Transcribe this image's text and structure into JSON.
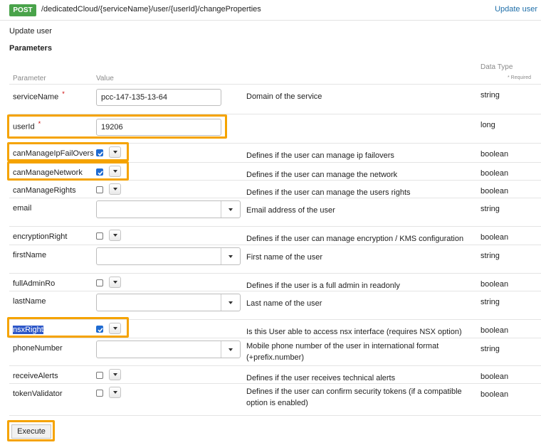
{
  "endpoint": {
    "method": "POST",
    "path": "/dedicatedCloud/{serviceName}/user/{userId}/changeProperties",
    "action_link": "Update user",
    "description": "Update user"
  },
  "section_title": "Parameters",
  "headers": {
    "parameter": "Parameter",
    "value": "Value",
    "data_type": "Data Type",
    "required_note": "* Required"
  },
  "params": [
    {
      "name": "serviceName",
      "required": true,
      "control": "text",
      "value": "pcc-147-135-13-64",
      "description": "Domain of the service",
      "type": "string"
    },
    {
      "name": "userId",
      "required": true,
      "control": "text",
      "value": "19206",
      "description": "",
      "type": "long"
    },
    {
      "name": "canManageIpFailOvers",
      "required": false,
      "control": "checkbox",
      "checked": true,
      "description": "Defines if the user can manage ip failovers",
      "type": "boolean"
    },
    {
      "name": "canManageNetwork",
      "required": false,
      "control": "checkbox",
      "checked": true,
      "description": "Defines if the user can manage the network",
      "type": "boolean"
    },
    {
      "name": "canManageRights",
      "required": false,
      "control": "checkbox",
      "checked": false,
      "description": "Defines if the user can manage the users rights",
      "type": "boolean"
    },
    {
      "name": "email",
      "required": false,
      "control": "combo",
      "value": "",
      "description": "Email address of the user",
      "type": "string"
    },
    {
      "name": "encryptionRight",
      "required": false,
      "control": "checkbox",
      "checked": false,
      "description": "Defines if the user can manage encryption / KMS configuration",
      "type": "boolean"
    },
    {
      "name": "firstName",
      "required": false,
      "control": "combo",
      "value": "",
      "description": "First name of the user",
      "type": "string"
    },
    {
      "name": "fullAdminRo",
      "required": false,
      "control": "checkbox",
      "checked": false,
      "description": "Defines if the user is a full admin in readonly",
      "type": "boolean"
    },
    {
      "name": "lastName",
      "required": false,
      "control": "combo",
      "value": "",
      "description": "Last name of the user",
      "type": "string"
    },
    {
      "name": "nsxRight",
      "required": false,
      "control": "checkbox",
      "checked": true,
      "description": "Is this User able to access nsx interface (requires NSX option)",
      "type": "boolean"
    },
    {
      "name": "phoneNumber",
      "required": false,
      "control": "combo",
      "value": "",
      "description_lines": [
        "Mobile phone number of the user in international format",
        "(+prefix.number)"
      ],
      "type": "string"
    },
    {
      "name": "receiveAlerts",
      "required": false,
      "control": "checkbox",
      "checked": false,
      "description": "Defines if the user receives technical alerts",
      "type": "boolean"
    },
    {
      "name": "tokenValidator",
      "required": false,
      "control": "checkbox",
      "checked": false,
      "description_lines": [
        "Defines if the user can confirm security tokens (if a compatible",
        "option is enabled)"
      ],
      "type": "boolean"
    }
  ],
  "execute_label": "Execute",
  "colors": {
    "post": "#49a34a",
    "link": "#1f6fa9",
    "highlight": "#f5a300",
    "selection": "#2d57c8",
    "checkbox_on": "#1f6bd1"
  }
}
